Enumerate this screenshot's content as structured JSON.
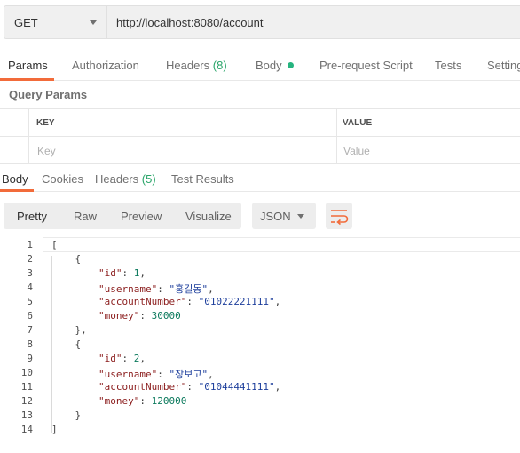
{
  "request": {
    "method": "GET",
    "url": "http://localhost:8080/account"
  },
  "request_tabs": {
    "params": "Params",
    "authorization": "Authorization",
    "headers": "Headers",
    "headers_count": "(8)",
    "body": "Body",
    "prerequest": "Pre-request Script",
    "tests": "Tests",
    "settings": "Settings"
  },
  "query_params": {
    "title": "Query Params",
    "key_header": "KEY",
    "value_header": "VALUE",
    "key_placeholder": "Key",
    "value_placeholder": "Value"
  },
  "response_tabs": {
    "body": "Body",
    "cookies": "Cookies",
    "headers": "Headers",
    "headers_count": "(5)",
    "test_results": "Test Results"
  },
  "view_modes": {
    "pretty": "Pretty",
    "raw": "Raw",
    "preview": "Preview",
    "visualize": "Visualize",
    "format": "JSON"
  },
  "response_lines": [
    {
      "no": "1",
      "indent": "",
      "pre": "[",
      "key": "",
      "sep": "",
      "val": "",
      "val_type": "",
      "post": ""
    },
    {
      "no": "2",
      "indent": "    ",
      "pre": "{",
      "key": "",
      "sep": "",
      "val": "",
      "val_type": "",
      "post": ""
    },
    {
      "no": "3",
      "indent": "        ",
      "pre": "",
      "key": "\"id\"",
      "sep": ": ",
      "val": "1",
      "val_type": "n",
      "post": ","
    },
    {
      "no": "4",
      "indent": "        ",
      "pre": "",
      "key": "\"username\"",
      "sep": ": ",
      "val": "\"홍길동\"",
      "val_type": "s",
      "post": ","
    },
    {
      "no": "5",
      "indent": "        ",
      "pre": "",
      "key": "\"accountNumber\"",
      "sep": ": ",
      "val": "\"01022221111\"",
      "val_type": "s",
      "post": ","
    },
    {
      "no": "6",
      "indent": "        ",
      "pre": "",
      "key": "\"money\"",
      "sep": ": ",
      "val": "30000",
      "val_type": "n",
      "post": ""
    },
    {
      "no": "7",
      "indent": "    ",
      "pre": "},",
      "key": "",
      "sep": "",
      "val": "",
      "val_type": "",
      "post": ""
    },
    {
      "no": "8",
      "indent": "    ",
      "pre": "{",
      "key": "",
      "sep": "",
      "val": "",
      "val_type": "",
      "post": ""
    },
    {
      "no": "9",
      "indent": "        ",
      "pre": "",
      "key": "\"id\"",
      "sep": ": ",
      "val": "2",
      "val_type": "n",
      "post": ","
    },
    {
      "no": "10",
      "indent": "        ",
      "pre": "",
      "key": "\"username\"",
      "sep": ": ",
      "val": "\"장보고\"",
      "val_type": "s",
      "post": ","
    },
    {
      "no": "11",
      "indent": "        ",
      "pre": "",
      "key": "\"accountNumber\"",
      "sep": ": ",
      "val": "\"01044441111\"",
      "val_type": "s",
      "post": ","
    },
    {
      "no": "12",
      "indent": "        ",
      "pre": "",
      "key": "\"money\"",
      "sep": ": ",
      "val": "120000",
      "val_type": "n",
      "post": ""
    },
    {
      "no": "13",
      "indent": "    ",
      "pre": "}",
      "key": "",
      "sep": "",
      "val": "",
      "val_type": "",
      "post": ""
    },
    {
      "no": "14",
      "indent": "",
      "pre": "]",
      "key": "",
      "sep": "",
      "val": "",
      "val_type": "",
      "post": ""
    }
  ],
  "colors": {
    "accent": "#f26b3a",
    "count_green": "#2aa56a",
    "body_dot": "#26b47f",
    "json_key": "#8b1d1d",
    "json_number": "#0c7a5d",
    "json_string": "#1e3f9c"
  },
  "icons": {
    "method_dropdown": "chevron-down-icon",
    "format_dropdown": "chevron-down-icon",
    "wrap": "wrap-lines-icon",
    "body_indicator": "dot-icon"
  }
}
